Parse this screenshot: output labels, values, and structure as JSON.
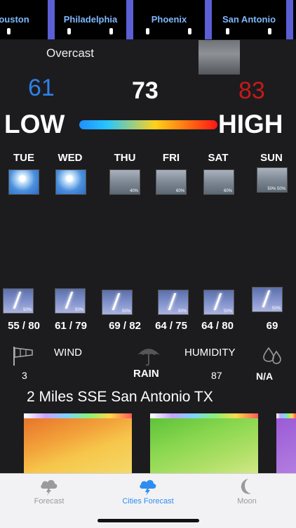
{
  "cities": [
    "ouston",
    "Philadelphia",
    "Phoenix",
    "San Antonio"
  ],
  "current": {
    "condition": "Overcast",
    "low": "61",
    "temp": "73",
    "high": "83",
    "low_label": "LOW",
    "high_label": "HIGH"
  },
  "days": [
    "TUE",
    "WED",
    "THU",
    "FRI",
    "SAT",
    "SUN"
  ],
  "forecast_top": [
    {
      "icon": "sunny",
      "pct": ""
    },
    {
      "icon": "sunny",
      "pct": ""
    },
    {
      "icon": "rain",
      "pct": "40%"
    },
    {
      "icon": "rain",
      "pct": "60%"
    },
    {
      "icon": "rain",
      "pct": "60%"
    },
    {
      "icon": "rain-storm",
      "pct": "50% 50%"
    }
  ],
  "forecast_bottom": [
    {
      "icon": "storm",
      "pct": "50%",
      "range": "55 / 80"
    },
    {
      "icon": "storm",
      "pct": "50%",
      "range": "61 / 79"
    },
    {
      "icon": "storm",
      "pct": "50%",
      "range": "69 / 82"
    },
    {
      "icon": "storm",
      "pct": "50%",
      "range": "64 / 75"
    },
    {
      "icon": "storm",
      "pct": "50%",
      "range": "64 / 80"
    },
    {
      "icon": "storm",
      "pct": "50%",
      "range": "69"
    }
  ],
  "details": {
    "wind_label": "WIND",
    "wind_value": "3",
    "rain_label": "RAIN",
    "humidity_label": "HUMIDITY",
    "humidity_value": "87",
    "extra_value": "N/A"
  },
  "location": "2 Miles SSE San Antonio TX",
  "tabs": [
    {
      "label": "Forecast",
      "icon": "cloud-storm-icon"
    },
    {
      "label": "Cities Forecast",
      "icon": "cloud-storm-icon"
    },
    {
      "label": "Moon",
      "icon": "moon-icon"
    }
  ],
  "colors": {
    "low": "#2f7fe8",
    "high": "#c41a1a",
    "accent": "#2e8df0",
    "tab_border": "#5a5fd6"
  }
}
